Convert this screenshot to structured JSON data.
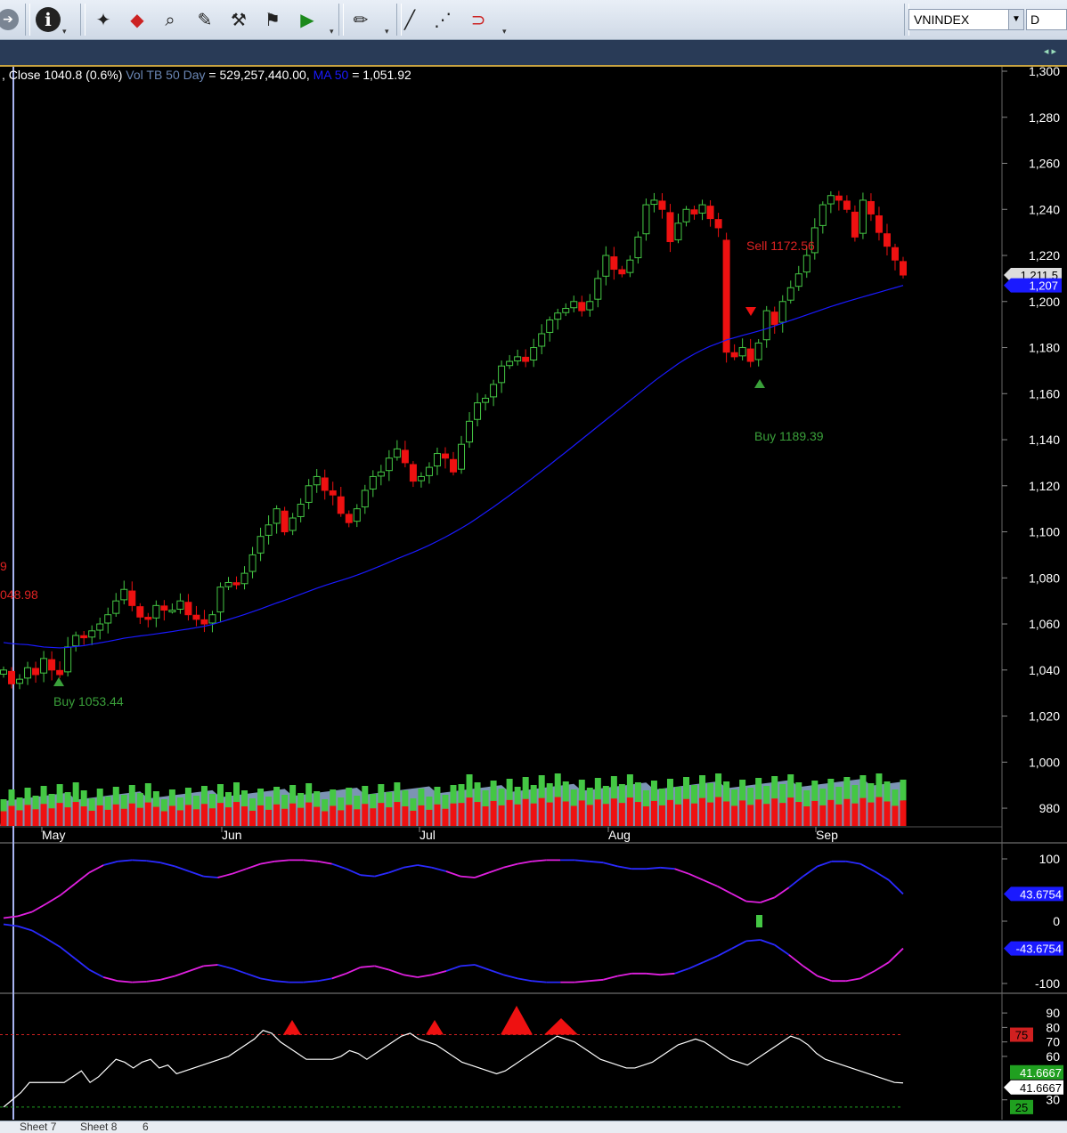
{
  "toolbar": {
    "buttons": [
      {
        "name": "back-arrow-icon",
        "glyph": "➔"
      },
      {
        "name": "info-icon",
        "glyph": "ℹ"
      },
      {
        "name": "scan-icon",
        "glyph": "✦"
      },
      {
        "name": "candles-icon",
        "glyph": "◆"
      },
      {
        "name": "binoculars-icon",
        "glyph": "⌕"
      },
      {
        "name": "notes-icon",
        "glyph": "✎"
      },
      {
        "name": "tools-icon",
        "glyph": "⚒"
      },
      {
        "name": "wand-icon",
        "glyph": "⚑"
      },
      {
        "name": "play-chart-icon",
        "glyph": "▶"
      },
      {
        "name": "pen-icon",
        "glyph": "✏"
      },
      {
        "name": "line-draw-icon",
        "glyph": "╱"
      },
      {
        "name": "dashed-line-icon",
        "glyph": "⋰"
      },
      {
        "name": "magnet-icon",
        "glyph": "⊃"
      }
    ],
    "symbol": "VNINDEX",
    "period": "D"
  },
  "legend": {
    "close_text": ", Close 1040.8 (0.6%)",
    "vol_text": "Vol TB 50 Day",
    "vol_value": " = 529,257,440.00,",
    "ma_text": "MA 50",
    "ma_value": " = 1,051.92"
  },
  "colors": {
    "bull": "#44c744",
    "bear": "#ee1111",
    "ma": "#1a1aff",
    "axis_text": "#ffffff",
    "volume_avg": "#8aa4c8"
  },
  "chart_data": [
    {
      "type": "candlestick",
      "ylim": [
        975,
        1300
      ],
      "yticks": [
        "1,300",
        "1,280",
        "1,260",
        "1,240",
        "1,220",
        "1,200",
        "1,180",
        "1,160",
        "1,140",
        "1,120",
        "1,100",
        "1,080",
        "1,060",
        "1,040",
        "1,020",
        "1,000",
        "980"
      ],
      "x_labels": [
        "May",
        "Jun",
        "Jul",
        "Aug",
        "Sep"
      ],
      "price_markers": [
        {
          "label": "1,211.5",
          "value": 1211.5
        },
        {
          "label": "1,207",
          "value": 1207
        }
      ],
      "annotations": [
        {
          "text": "Buy 1053.44",
          "color": "#3aa03a"
        },
        {
          "text": "Sell 1172.56",
          "color": "#dd2222"
        },
        {
          "text": "Buy 1189.39",
          "color": "#3aa03a"
        },
        {
          "text": "9",
          "color": "#dd2222"
        },
        {
          "text": "048.98",
          "color": "#dd2222"
        }
      ],
      "closes": [
        1040,
        1034,
        1036,
        1041,
        1038,
        1045,
        1040,
        1038,
        1050,
        1055,
        1054,
        1057,
        1060,
        1064,
        1070,
        1075,
        1068,
        1063,
        1062,
        1068,
        1066,
        1066,
        1070,
        1064,
        1062,
        1060,
        1064,
        1076,
        1078,
        1077,
        1082,
        1090,
        1098,
        1103,
        1110,
        1100,
        1106,
        1112,
        1120,
        1124,
        1118,
        1116,
        1108,
        1104,
        1110,
        1118,
        1124,
        1126,
        1132,
        1136,
        1130,
        1122,
        1124,
        1128,
        1134,
        1132,
        1126,
        1138,
        1148,
        1156,
        1158,
        1164,
        1172,
        1174,
        1176,
        1174,
        1180,
        1186,
        1192,
        1195,
        1197,
        1200,
        1196,
        1200,
        1210,
        1220,
        1214,
        1212,
        1218,
        1228,
        1242,
        1244,
        1240,
        1226,
        1234,
        1240,
        1238,
        1242,
        1236,
        1232,
        1178,
        1176,
        1180,
        1174,
        1182,
        1196,
        1190,
        1200,
        1206,
        1212,
        1220,
        1232,
        1242,
        1246,
        1244,
        1240,
        1228,
        1244,
        1238,
        1230,
        1224,
        1218,
        1211.5
      ],
      "ma50": [
        1051.92,
        1051.5,
        1051.2,
        1051.0,
        1050.5,
        1050.0,
        1049.8,
        1049.6,
        1049.8,
        1050.2,
        1050.6,
        1051.2,
        1051.8,
        1052.4,
        1053.1,
        1053.8,
        1054.3,
        1054.8,
        1055.2,
        1055.7,
        1056.2,
        1056.7,
        1057.3,
        1057.8,
        1058.4,
        1059.0,
        1059.8,
        1060.8,
        1061.9,
        1063.0,
        1064.1,
        1065.3,
        1066.5,
        1067.8,
        1069.1,
        1070.3,
        1071.6,
        1072.9,
        1074.2,
        1075.5,
        1076.7,
        1077.8,
        1078.9,
        1080.0,
        1081.2,
        1082.5,
        1083.9,
        1085.3,
        1086.8,
        1088.3,
        1089.7,
        1091.1,
        1092.6,
        1094.2,
        1095.9,
        1097.7,
        1099.6,
        1101.6,
        1103.7,
        1106.0,
        1108.4,
        1110.8,
        1113.3,
        1115.8,
        1118.4,
        1121.0,
        1123.7,
        1126.4,
        1129.1,
        1131.9,
        1134.6,
        1137.4,
        1140.2,
        1143.0,
        1145.8,
        1148.6,
        1151.4,
        1154.2,
        1157.0,
        1159.8,
        1162.6,
        1165.4,
        1168.0,
        1170.5,
        1173.0,
        1175.2,
        1177.2,
        1179.0,
        1180.6,
        1181.9,
        1183.3,
        1184.3,
        1185.3,
        1186.2,
        1187.2,
        1188.2,
        1189.4,
        1190.6,
        1191.8,
        1193.0,
        1194.2,
        1195.4,
        1196.6,
        1197.8,
        1198.9,
        1200.0,
        1201.0,
        1202.0,
        1203.0,
        1204.0,
        1205.0,
        1206.0,
        1207.0
      ]
    },
    {
      "type": "line",
      "ylim": [
        -100,
        100
      ],
      "yticks": [
        "100",
        "0",
        "-100"
      ],
      "markers": [
        {
          "label": "43.6754",
          "value": 43.6754
        },
        {
          "label": "-43.6754",
          "value": -43.6754
        }
      ],
      "series": [
        {
          "values": [
            5,
            8,
            15,
            28,
            42,
            60,
            78,
            90,
            96,
            98,
            97,
            94,
            88,
            80,
            72,
            70,
            76,
            84,
            92,
            96,
            98,
            98,
            96,
            92,
            84,
            74,
            72,
            78,
            86,
            90,
            86,
            80,
            72,
            70,
            78,
            86,
            92,
            96,
            98,
            98,
            98,
            96,
            94,
            88,
            84,
            84,
            86,
            84,
            76,
            66,
            56,
            44,
            32,
            30,
            38,
            54,
            72,
            88,
            96,
            96,
            92,
            80,
            66,
            43.6754
          ]
        },
        {
          "values": [
            -5,
            -8,
            -15,
            -28,
            -42,
            -60,
            -78,
            -90,
            -96,
            -98,
            -97,
            -94,
            -88,
            -80,
            -72,
            -70,
            -76,
            -84,
            -92,
            -96,
            -98,
            -98,
            -96,
            -92,
            -84,
            -74,
            -72,
            -78,
            -86,
            -90,
            -86,
            -80,
            -72,
            -70,
            -78,
            -86,
            -92,
            -96,
            -98,
            -98,
            -98,
            -96,
            -94,
            -88,
            -84,
            -84,
            -86,
            -84,
            -76,
            -66,
            -56,
            -44,
            -32,
            -30,
            -38,
            -54,
            -72,
            -88,
            -96,
            -96,
            -92,
            -80,
            -66,
            -43.6754
          ]
        }
      ]
    },
    {
      "type": "line",
      "ylim": [
        20,
        95
      ],
      "yticks": [
        "90",
        "80",
        "70",
        "60",
        "30"
      ],
      "reference_lines": [
        {
          "label": "75",
          "value": 75
        },
        {
          "label": "25",
          "value": 25
        }
      ],
      "markers": [
        {
          "label": "41.6667",
          "value": 41.6667
        },
        {
          "label": "41.6667",
          "value": 41.6667
        }
      ],
      "series": [
        {
          "values": [
            25,
            30,
            35,
            42,
            42,
            42,
            42,
            42,
            46,
            50,
            42,
            46,
            52,
            58,
            56,
            52,
            56,
            58,
            52,
            54,
            48,
            50,
            52,
            54,
            56,
            58,
            60,
            64,
            68,
            72,
            78,
            76,
            70,
            66,
            62,
            58,
            58,
            58,
            58,
            60,
            64,
            62,
            58,
            62,
            66,
            70,
            74,
            76,
            72,
            70,
            68,
            64,
            60,
            56,
            54,
            52,
            50,
            48,
            50,
            54,
            58,
            62,
            66,
            70,
            74,
            72,
            70,
            66,
            62,
            58,
            56,
            54,
            52,
            52,
            54,
            56,
            60,
            64,
            68,
            70,
            72,
            70,
            66,
            62,
            58,
            56,
            54,
            58,
            62,
            66,
            70,
            74,
            72,
            68,
            62,
            58,
            56,
            54,
            52,
            50,
            48,
            46,
            44,
            42,
            41.6667
          ]
        }
      ]
    }
  ],
  "sheet_tabs": [
    "Sheet 7",
    "Sheet 8",
    "6"
  ]
}
